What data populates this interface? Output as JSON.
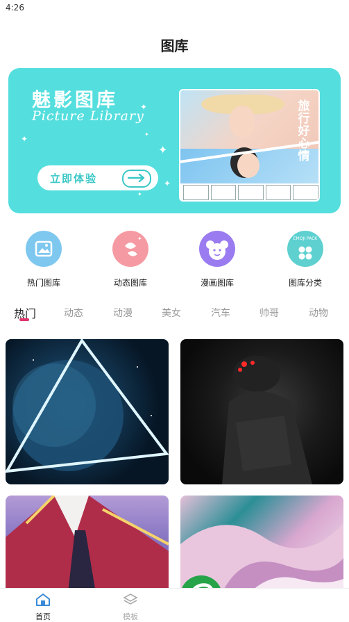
{
  "status": {
    "time": "4:26"
  },
  "header": {
    "title": "图库"
  },
  "banner": {
    "title": "魅影图库",
    "subtitle": "Picture Library",
    "cta_label": "立即体验",
    "photo_caption": "旅行好心情",
    "colors": {
      "background": "#55dede",
      "accent": "#3bc7c7"
    }
  },
  "categories": [
    {
      "label": "热门图库",
      "icon": "picture-icon",
      "color": "#7ec8f0"
    },
    {
      "label": "动态图库",
      "icon": "swirl-icon",
      "color": "#f59aa2"
    },
    {
      "label": "漫画图库",
      "icon": "bear-face-icon",
      "color": "#9a7cf0"
    },
    {
      "label": "图库分类",
      "icon": "emoji-pack-icon",
      "badge": "EMOJI PACK",
      "color": "#5fd0d0"
    }
  ],
  "tabs": [
    "热门",
    "动态",
    "动漫",
    "美女",
    "汽车",
    "帅哥",
    "动物"
  ],
  "active_tab": "热门",
  "bottom_nav": [
    {
      "label": "首页",
      "icon": "home-icon"
    },
    {
      "label": "模板",
      "icon": "layers-icon"
    }
  ]
}
